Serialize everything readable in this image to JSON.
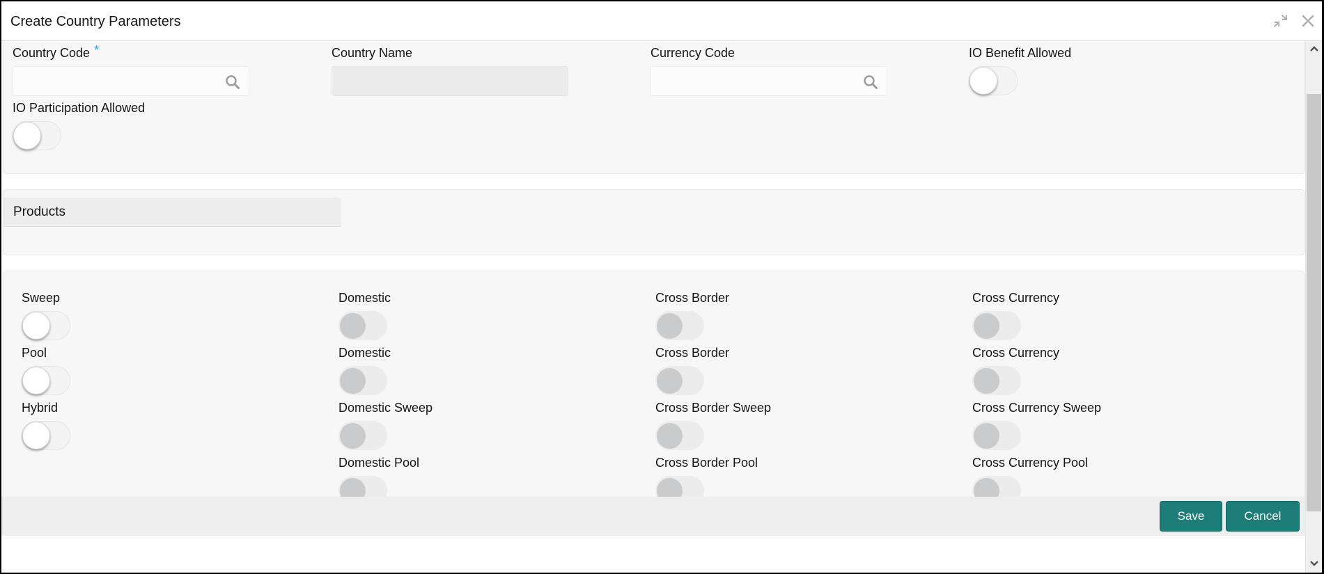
{
  "window": {
    "title": "Create Country Parameters",
    "icons": {
      "restore": "shrink-arrows-icon",
      "close": "close-icon"
    }
  },
  "general": {
    "country_code": {
      "label": "Country Code",
      "required_mark": "*",
      "value": "",
      "placeholder": ""
    },
    "country_name": {
      "label": "Country Name",
      "value": "",
      "readonly": true
    },
    "currency_code": {
      "label": "Currency Code",
      "value": "",
      "placeholder": ""
    },
    "io_benefit_allowed": {
      "label": "IO Benefit Allowed",
      "on": false
    },
    "io_participation_allowed": {
      "label": "IO Participation Allowed",
      "on": false
    }
  },
  "products": {
    "tab_label": "Products",
    "rows": [
      {
        "main": {
          "label": "Sweep",
          "on": false,
          "enabled": true
        },
        "options": [
          {
            "label": "Domestic",
            "on": false,
            "enabled": false
          },
          {
            "label": "Cross Border",
            "on": false,
            "enabled": false
          },
          {
            "label": "Cross Currency",
            "on": false,
            "enabled": false
          }
        ]
      },
      {
        "main": {
          "label": "Pool",
          "on": false,
          "enabled": true
        },
        "options": [
          {
            "label": "Domestic",
            "on": false,
            "enabled": false
          },
          {
            "label": "Cross Border",
            "on": false,
            "enabled": false
          },
          {
            "label": "Cross Currency",
            "on": false,
            "enabled": false
          }
        ]
      },
      {
        "main": {
          "label": "Hybrid",
          "on": false,
          "enabled": true
        },
        "options": [
          {
            "label": "Domestic Sweep",
            "on": false,
            "enabled": false
          },
          {
            "label": "Cross Border Sweep",
            "on": false,
            "enabled": false
          },
          {
            "label": "Cross Currency Sweep",
            "on": false,
            "enabled": false
          }
        ]
      },
      {
        "main": null,
        "options": [
          {
            "label": "Domestic Pool",
            "on": false,
            "enabled": false
          },
          {
            "label": "Cross Border Pool",
            "on": false,
            "enabled": false
          },
          {
            "label": "Cross Currency Pool",
            "on": false,
            "enabled": false
          }
        ]
      }
    ]
  },
  "footer": {
    "save_label": "Save",
    "cancel_label": "Cancel"
  },
  "colors": {
    "primary_button": "#1d7d79",
    "required_asterisk": "#2d9cdb",
    "panel_bg": "#f7f7f7",
    "disabled_knob": "#cacbcd"
  }
}
